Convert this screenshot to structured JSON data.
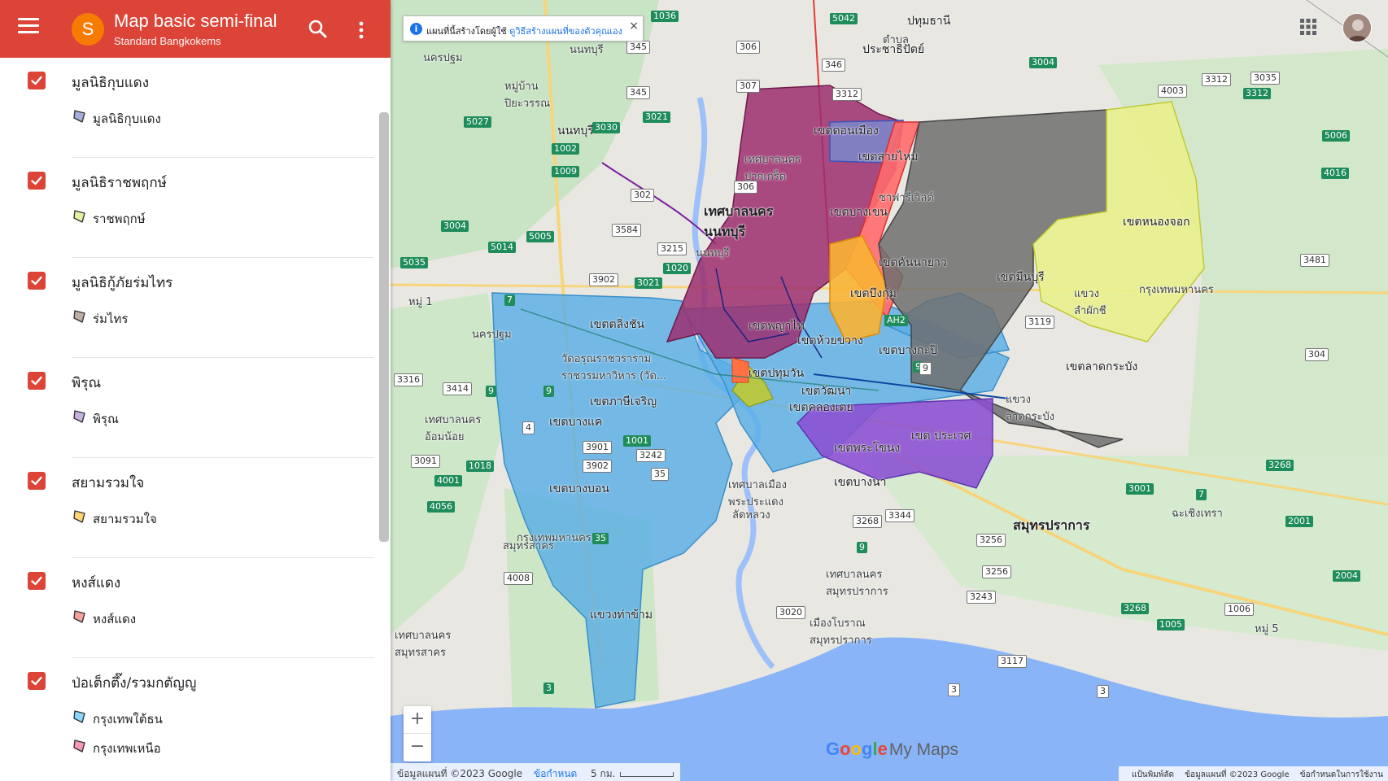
{
  "header": {
    "title": "Map basic semi-final",
    "subtitle": "Standard Bangkokems",
    "avatar_letter": "S"
  },
  "colors": {
    "header_bg": "#db4437",
    "checkbox": "#db4437",
    "zone_blue": "#5aaee6",
    "zone_maroon": "#9c2e6e",
    "zone_red": "#ff6b6b",
    "zone_orange": "#f9b233",
    "zone_gray": "#6e6e6e",
    "zone_yellow": "#e9f08c",
    "zone_purple": "#8a4fd1",
    "zone_periwinkle": "#7d84c9"
  },
  "layers": [
    {
      "title": "มูลนิธิกุบแดง",
      "checked": true,
      "items": [
        {
          "label": "มูลนิธิกุบแดง",
          "color": "#5c6bc0"
        }
      ]
    },
    {
      "title": "มูลนิธิราชพฤกษ์",
      "checked": true,
      "items": [
        {
          "label": "ราชพฤกษ์",
          "color": "#d4e157"
        }
      ]
    },
    {
      "title": "มูลนิธิกู้ภัยร่มไทร",
      "checked": true,
      "items": [
        {
          "label": "ร่มไทร",
          "color": "#8d6e63"
        }
      ]
    },
    {
      "title": "พิรุณ",
      "checked": true,
      "items": [
        {
          "label": "พิรุณ",
          "color": "#9575cd"
        }
      ]
    },
    {
      "title": "สยามรวมใจ",
      "checked": true,
      "items": [
        {
          "label": "สยามรวมใจ",
          "color": "#ffb300"
        }
      ]
    },
    {
      "title": "หงส์แดง",
      "checked": true,
      "items": [
        {
          "label": "หงส์แดง",
          "color": "#ef5350"
        }
      ]
    },
    {
      "title": "ป่อเต็กตึ๊ง/รวมกตัญญู",
      "checked": true,
      "items": [
        {
          "label": "กรุงเทพใต้ธน",
          "color": "#29b6f6"
        },
        {
          "label": "กรุงเทพเหนือ",
          "color": "#ec407a"
        }
      ]
    }
  ],
  "notice": {
    "text": "แผนที่นี้สร้างโดยผู้ใช้",
    "link": "ดูวิธีสร้างแผนที่ของตัวคุณเอง",
    "close": "×"
  },
  "map_labels": {
    "pathum_thani": "ปทุมธานี",
    "tambon": "ตำบล",
    "prachathipat": "ประชาธิปัตย์",
    "nonthaburi_1": "นนทบุรี",
    "nonthaburi_2": "นนทบุรี",
    "nonthaburi_3": "นนทบุรี",
    "nakhon_pathom_1": "นครปฐม",
    "nakhon_pathom_2": "นครปฐม",
    "nonthaburi_city": "เทศบาลนคร\nนนทบุรี",
    "pakkret": "เทศบาลนคร\nปากเกร็ด",
    "don_mueang": "เขตดอนเมือง",
    "sai_mai": "เขตสายไหม",
    "safari": "ซาฟารีเวิลด์",
    "bang_khen": "เขตบางเขน",
    "khan_na_yao": "เขตคันนายาว",
    "bueng_kum": "เขตบึงกุ่ม",
    "min_buri": "เขตมีนบุรี",
    "nong_chok": "เขตหนองจอก",
    "lam_phak_chi": "แขวง\nลำผักชี",
    "taling_chan": "เขตตลิ่งชัน",
    "phaya_thai": "เขตพญาไท",
    "huai_khwang": "เขตห้วยขวาง",
    "bang_kapi": "เขตบางกะปิ",
    "pathum_wan": "เขตปทุมวัน",
    "wat_arun": "วัดอรุณราชวราราม\nราชวรมหาวิหาร (วัด...",
    "phasi_charoen": "เขตภาษีเจริญ",
    "bang_khae": "เขตบางแค",
    "watthana": "เขตวัฒนา",
    "khlong_toei": "เขตคลองเตย",
    "lat_krabang": "เขตลาดกระบัง",
    "lat_krabang_khwaeng": "แขวง\nลาดกระบัง",
    "prawet": "เขต ประเวศ",
    "phra_khanong": "เขตพระโขนง",
    "bang_na": "เขตบางนา",
    "bang_bon": "เขตบางบอน",
    "tha_kham": "แขวงท่าข้าม",
    "phra_pradaeng": "เทศบาลเมือง\nพระประแดง",
    "lat_luang": "ลัดหลวง",
    "samut_prakan": "สมุทรปราการ",
    "samut_prakan_city": "เทศบาลนคร\nสมุทรปราการ",
    "muang_boran": "เมืองโบราณ\nสมุทรปราการ",
    "samut_sakhon_city": "เทศบาลนคร\nสมุทรสาคร",
    "samut_sakhon": "สมุทรสาคร",
    "om_noi": "เทศบาลนคร\nอ้อมน้อย",
    "bangkok_vertical": "กรุงเทพมหานคร",
    "chachoengsao": "ฉะเชิงเทรา",
    "bkk_road": "กรุงเทพมหานคร",
    "village_1": "หมู่บ้าน\nปิยะวรรณ",
    "moo1": "หมู่ 1",
    "moo5": "หมู่ 5"
  },
  "shields": [
    "1036",
    "5042",
    "306",
    "345",
    "346",
    "3312",
    "3004",
    "3312",
    "4003",
    "3312",
    "3035",
    "5006",
    "5027",
    "345",
    "3021",
    "307",
    "3030",
    "1002",
    "1009",
    "302",
    "306",
    "4016",
    "3004",
    "5014",
    "5005",
    "3584",
    "3215",
    "5035",
    "1020",
    "3902",
    "3021",
    "3481",
    "3119",
    "304",
    "3316",
    "3414",
    "4",
    "1001",
    "3901",
    "3902",
    "3242",
    "35",
    "1018",
    "4001",
    "4056",
    "3091",
    "3268",
    "3344",
    "3256",
    "3268",
    "3001",
    "2001",
    "2004",
    "3020",
    "3243",
    "3256",
    "3268",
    "1006",
    "1005",
    "3117",
    "3",
    "3",
    "3",
    "4008",
    "35",
    "9",
    "7",
    "9",
    "9",
    "9",
    "7",
    "9",
    "AH2"
  ],
  "zoom": {
    "in": "+",
    "out": "−"
  },
  "brand": {
    "google": [
      "G",
      "o",
      "o",
      "g",
      "l",
      "e"
    ],
    "mymaps": "My Maps"
  },
  "footer": {
    "copyright": "ข้อมูลแผนที่ ©2023 Google",
    "terms": "ข้อกำหนด",
    "scale": "5 กม.",
    "shortcuts": "แป้นพิมพ์ลัด",
    "map_data": "ข้อมูลแผนที่ ©2023 Google",
    "terms_of_use": "ข้อกำหนดในการใช้งาน"
  }
}
